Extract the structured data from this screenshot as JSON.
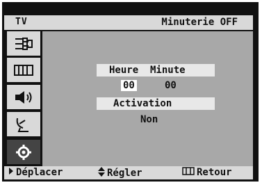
{
  "header": {
    "left_label": "TV",
    "right_label": "Minuterie OFF"
  },
  "sidebar": {
    "items": [
      {
        "icon": "input-plug-icon",
        "selected": false
      },
      {
        "icon": "picture-grid-icon",
        "selected": false
      },
      {
        "icon": "speaker-icon",
        "selected": false
      },
      {
        "icon": "satellite-dish-icon",
        "selected": false
      },
      {
        "icon": "gear-icon",
        "selected": true
      }
    ]
  },
  "timer": {
    "time_header": "Heure  Minute",
    "hour_value": "00",
    "minute_value": "00",
    "activation_header": "Activation",
    "activation_value": "Non"
  },
  "footer": {
    "move_label": "Déplacer",
    "adjust_label": "Régler",
    "return_label": "Retour"
  },
  "colors": {
    "frame": "#111111",
    "panel": "#a8a8a8",
    "bar": "#d9d9d9",
    "highlight": "#ffffff"
  }
}
